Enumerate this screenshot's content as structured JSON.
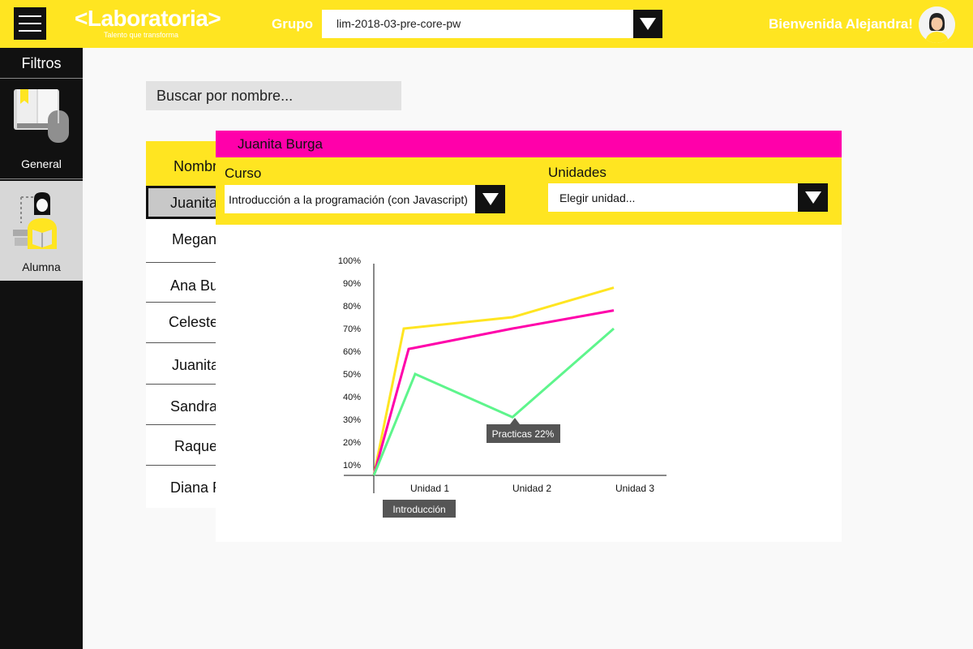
{
  "header": {
    "logo_text": "<Laboratoria>",
    "logo_tagline": "Talento que transforma",
    "group_label": "Grupo",
    "group_value": "lim-2018-03-pre-core-pw",
    "welcome": "Bienvenida Alejandra!"
  },
  "sidebar": {
    "title": "Filtros",
    "items": [
      {
        "label": "General"
      },
      {
        "label": "Alumna"
      }
    ]
  },
  "search": {
    "placeholder": "Buscar por nombre..."
  },
  "student_list": {
    "header": "Nombr",
    "rows": [
      "Juanita",
      "Megan",
      "Ana Bu",
      "Celeste",
      "Juanita",
      "Sandra",
      "Raque",
      "Diana F"
    ]
  },
  "detail": {
    "student_name": "Juanita Burga",
    "course_label": "Curso",
    "course_value": "Introducción a la programación (con Javascript)",
    "units_label": "Unidades",
    "units_value": "Elegir unidad..."
  },
  "colors": {
    "accent": "#ffe521",
    "magenta": "#ff00aa",
    "green": "#5ef58c",
    "dark": "#111111"
  },
  "chart_data": {
    "type": "line",
    "x": [
      "",
      "Unidad 1",
      "Unidad 2",
      "Unidad 3"
    ],
    "yticks": [
      "10%",
      "20%",
      "30%",
      "40%",
      "50%",
      "60%",
      "70%",
      "80%",
      "90%",
      "100%"
    ],
    "ylim": [
      5,
      100
    ],
    "series": [
      {
        "values": [
          5,
          70,
          75,
          88
        ],
        "color": "#ffe521"
      },
      {
        "values": [
          5,
          61,
          70,
          78
        ],
        "color": "#ff00aa"
      },
      {
        "values": [
          5,
          50,
          31,
          70
        ],
        "color": "#5ef58c"
      }
    ],
    "annotations": [
      {
        "text": "Practicas 22%"
      },
      {
        "text": "Introducción"
      }
    ]
  }
}
